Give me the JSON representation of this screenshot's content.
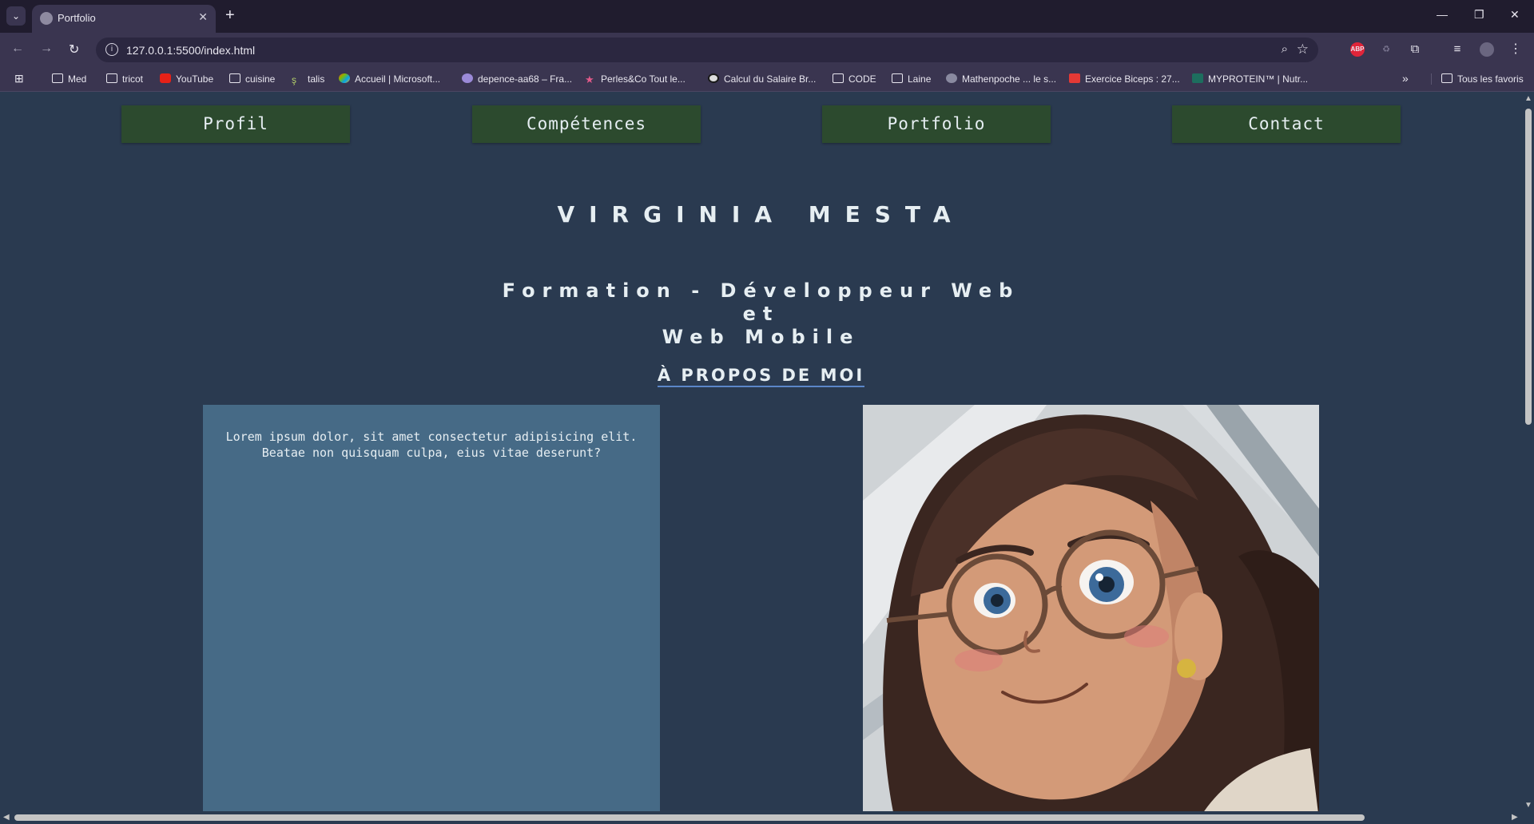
{
  "browser": {
    "tab_title": "Portfolio",
    "url": "127.0.0.1:5500/index.html",
    "bookmarks": [
      {
        "label": "Med",
        "icon": "folder-icon"
      },
      {
        "label": "tricot",
        "icon": "folder-icon"
      },
      {
        "label": "YouTube",
        "icon": "youtube-icon"
      },
      {
        "label": "cuisine",
        "icon": "folder-icon"
      },
      {
        "label": "talis",
        "icon": "talis-icon"
      },
      {
        "label": "Accueil | Microsoft...",
        "icon": "microsoft-icon"
      },
      {
        "label": "depence-aa68 – Fra...",
        "icon": "sheet-icon"
      },
      {
        "label": "Perles&Co Tout le...",
        "icon": "star-icon"
      },
      {
        "label": "Calcul du Salaire Br...",
        "icon": "calc-icon"
      },
      {
        "label": "CODE",
        "icon": "folder-icon"
      },
      {
        "label": "Laine",
        "icon": "folder-icon"
      },
      {
        "label": "Mathenpoche ... le s...",
        "icon": "globe-icon"
      },
      {
        "label": "Exercice Biceps : 27...",
        "icon": "df-icon"
      },
      {
        "label": "MYPROTEIN™ | Nutr...",
        "icon": "myprotein-icon"
      }
    ],
    "all_bookmarks": "Tous les favoris"
  },
  "nav": {
    "profil": "Profil",
    "competences": "Compétences",
    "portfolio": "Portfolio",
    "contact": "Contact"
  },
  "hero": {
    "name": "VIRGINIA MESTA",
    "formation_line1": "Formation - Développeur Web et",
    "formation_line2": "Web Mobile",
    "about_heading": "À PROPOS DE MOI",
    "about_text_line1": "Lorem ipsum dolor, sit amet consectetur adipisicing elit.",
    "about_text_line2": "Beatae non quisquam culpa, eius vitae deserunt?"
  },
  "colors": {
    "page_bg": "#2a3a50",
    "nav_button_bg": "#2c4a2e",
    "about_box_bg": "#466a86",
    "underline": "#5b86c8"
  }
}
